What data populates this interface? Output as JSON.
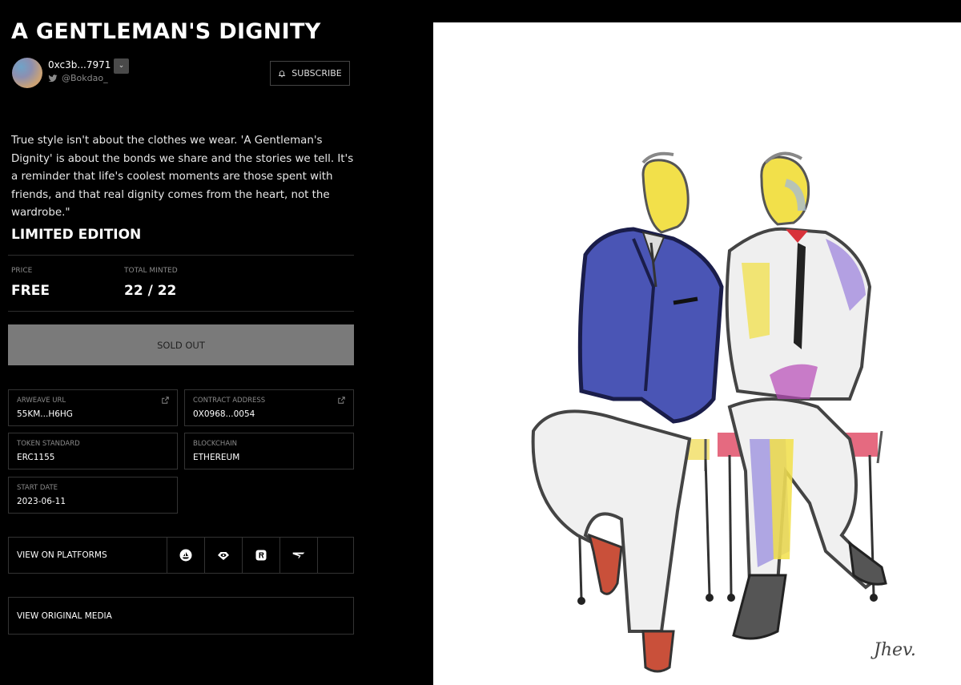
{
  "nft": {
    "title": "A GENTLEMAN'S DIGNITY",
    "description": "True style isn't about the clothes we wear. 'A Gentleman's Dignity' is about the bonds we share and the stories we tell. It's a reminder that life's coolest moments are those spent with friends, and that real dignity comes from the heart, not the wardrobe.\""
  },
  "creator": {
    "address": "0xc3b...7971",
    "twitter": "@Bokdao_",
    "dropdown_glyph": "⌄"
  },
  "subscribe": {
    "label": "SUBSCRIBE"
  },
  "edition": {
    "heading": "LIMITED EDITION",
    "price_label": "PRICE",
    "price_value": "FREE",
    "minted_label": "TOTAL MINTED",
    "minted_value": "22 / 22",
    "status_button": "SOLD OUT"
  },
  "details": {
    "arweave": {
      "label": "ARWEAVE URL",
      "value": "55KM...H6HG"
    },
    "contract": {
      "label": "CONTRACT ADDRESS",
      "value": "0X0968...0054"
    },
    "token_standard": {
      "label": "TOKEN STANDARD",
      "value": "ERC1155"
    },
    "blockchain": {
      "label": "BLOCKCHAIN",
      "value": "ETHEREUM"
    },
    "start_date": {
      "label": "START DATE",
      "value": "2023-06-11"
    }
  },
  "platforms": {
    "label": "VIEW ON PLATFORMS",
    "icons": [
      "opensea-icon",
      "looksrare-icon",
      "rarible-icon",
      "zora-icon"
    ]
  },
  "original_media": {
    "label": "VIEW ORIGINAL MEDIA"
  },
  "artwork": {
    "signature": "Jhev."
  },
  "colors": {
    "background": "#000000",
    "button_disabled": "#7a7a7a",
    "border": "#333333",
    "muted_text": "#8a8a8a"
  }
}
